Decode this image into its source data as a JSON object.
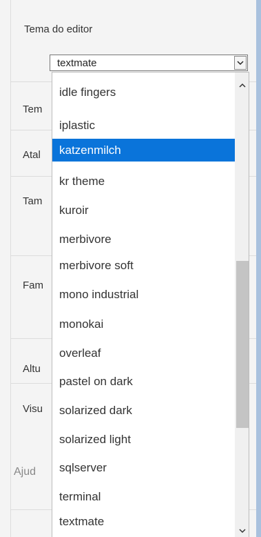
{
  "settings": {
    "editor_theme_label": "Tema do editor",
    "row_labels": [
      "Tem",
      "Atal",
      "Tam",
      "Fam",
      "Altu",
      "Visu"
    ],
    "help_section": "Ajud"
  },
  "theme_select": {
    "value": "textmate",
    "options": [
      "idle fingers",
      "iplastic",
      "katzenmilch",
      "kr theme",
      "kuroir",
      "merbivore",
      "merbivore soft",
      "mono industrial",
      "monokai",
      "overleaf",
      "pastel on dark",
      "solarized dark",
      "solarized light",
      "sqlserver",
      "terminal",
      "textmate"
    ],
    "highlighted": "katzenmilch"
  },
  "colors": {
    "highlight": "#0a74da",
    "background": "#f4f4f4",
    "frame": "#a9c1de"
  },
  "icons": {
    "select_arrow": "chevron-down-icon",
    "scroll_up": "chevron-up-icon",
    "scroll_down": "chevron-down-icon"
  }
}
